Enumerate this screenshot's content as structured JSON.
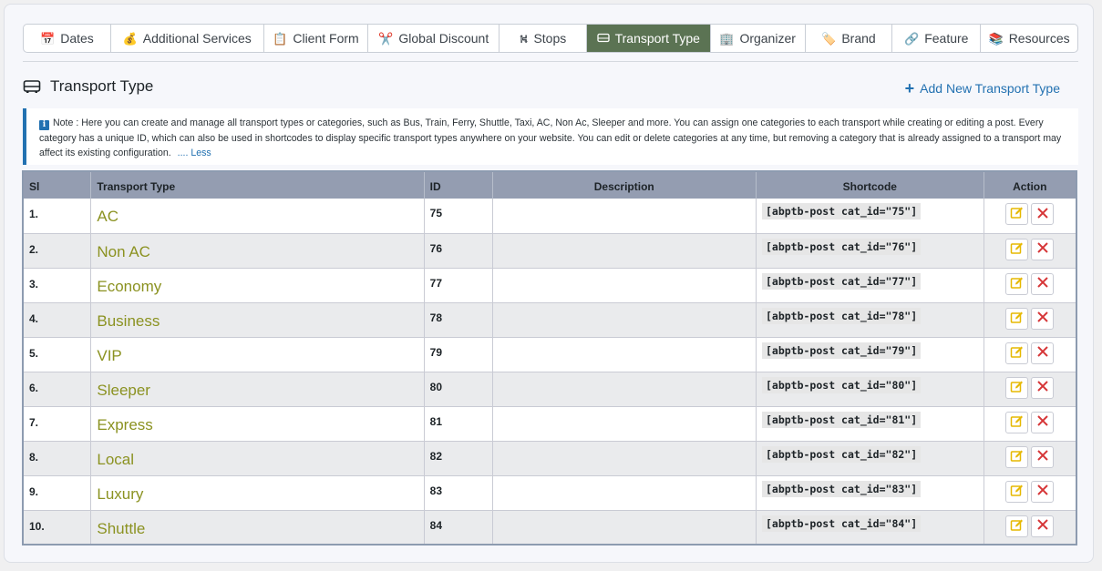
{
  "tabs": [
    {
      "label": "Dates",
      "icon": "calendar-icon",
      "glyph": "📅"
    },
    {
      "label": "Additional Services",
      "icon": "money-bag-icon",
      "glyph": "💰"
    },
    {
      "label": "Client Form",
      "icon": "clipboard-icon",
      "glyph": "📋"
    },
    {
      "label": "Global Discount",
      "icon": "scissors-icon",
      "glyph": "✂️"
    },
    {
      "label": "Stops",
      "icon": "route-icon",
      "glyph": "⛕"
    },
    {
      "label": "Transport Type",
      "icon": "bus-icon",
      "glyph": "",
      "active": true
    },
    {
      "label": "Organizer",
      "icon": "building-icon",
      "glyph": "🏢"
    },
    {
      "label": "Brand",
      "icon": "tag-icon",
      "glyph": "🏷️"
    },
    {
      "label": "Feature",
      "icon": "link-icon",
      "glyph": "🔗"
    },
    {
      "label": "Resources",
      "icon": "books-icon",
      "glyph": "📚"
    }
  ],
  "section": {
    "title": "Transport Type",
    "add_label": "Add New Transport Type"
  },
  "note": {
    "text": "Note : Here you can create and manage all transport types or categories, such as Bus, Train, Ferry, Shuttle, Taxi, AC, Non Ac, Sleeper and more. You can assign one categories to each transport while creating or editing a post. Every category has a unique ID, which can also be used in shortcodes to display specific transport types anywhere on your website. You can edit or delete categories at any time, but removing a category that is already assigned to a transport may affect its existing configuration.",
    "less_label": ".... Less"
  },
  "table": {
    "headers": [
      "Sl",
      "Transport Type",
      "ID",
      "Description",
      "Shortcode",
      "Action"
    ],
    "rows": [
      {
        "sl": "1.",
        "name": "AC",
        "id": "75",
        "description": "",
        "shortcode": "[abptb-post cat_id=\"75\"]"
      },
      {
        "sl": "2.",
        "name": "Non AC",
        "id": "76",
        "description": "",
        "shortcode": "[abptb-post cat_id=\"76\"]"
      },
      {
        "sl": "3.",
        "name": "Economy",
        "id": "77",
        "description": "",
        "shortcode": "[abptb-post cat_id=\"77\"]"
      },
      {
        "sl": "4.",
        "name": "Business",
        "id": "78",
        "description": "",
        "shortcode": "[abptb-post cat_id=\"78\"]"
      },
      {
        "sl": "5.",
        "name": "VIP",
        "id": "79",
        "description": "",
        "shortcode": "[abptb-post cat_id=\"79\"]"
      },
      {
        "sl": "6.",
        "name": "Sleeper",
        "id": "80",
        "description": "",
        "shortcode": "[abptb-post cat_id=\"80\"]"
      },
      {
        "sl": "7.",
        "name": "Express",
        "id": "81",
        "description": "",
        "shortcode": "[abptb-post cat_id=\"81\"]"
      },
      {
        "sl": "8.",
        "name": "Local",
        "id": "82",
        "description": "",
        "shortcode": "[abptb-post cat_id=\"82\"]"
      },
      {
        "sl": "9.",
        "name": "Luxury",
        "id": "83",
        "description": "",
        "shortcode": "[abptb-post cat_id=\"83\"]"
      },
      {
        "sl": "10.",
        "name": "Shuttle",
        "id": "84",
        "description": "",
        "shortcode": "[abptb-post cat_id=\"84\"]"
      }
    ]
  },
  "colors": {
    "active_tab": "#5b7353",
    "accent": "#2271b1",
    "type_name": "#8b9221",
    "header_bg": "#949db1",
    "edit_icon": "#e6b800",
    "delete_icon": "#d63638"
  }
}
